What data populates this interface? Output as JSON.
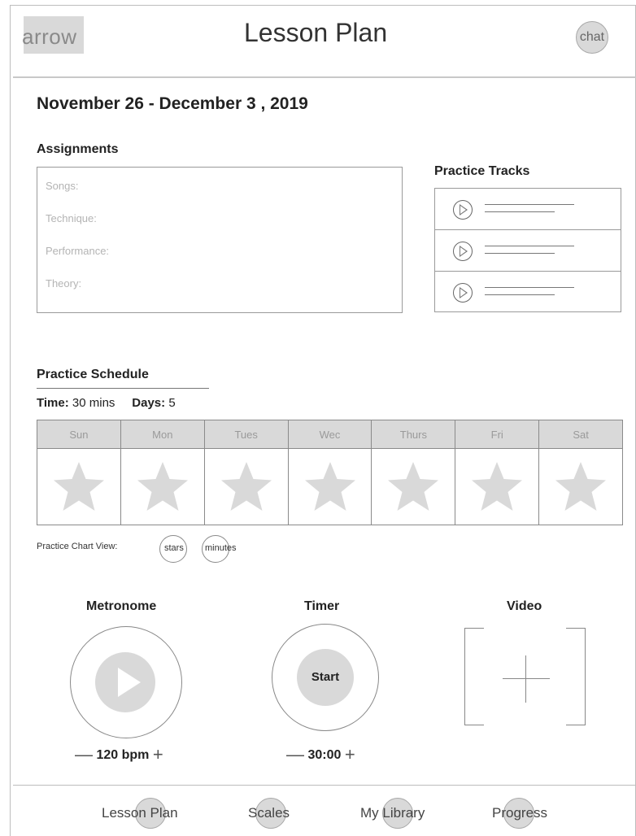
{
  "header": {
    "back_label": "arrow",
    "title": "Lesson Plan",
    "chat_label": "chat"
  },
  "date_range": "November 26 - December 3 , 2019",
  "assignments": {
    "heading": "Assignments",
    "items": [
      "Songs:",
      "Technique:",
      "Performance:",
      "Theory:"
    ]
  },
  "practice_tracks": {
    "heading": "Practice Tracks",
    "count": 3
  },
  "schedule": {
    "heading": "Practice Schedule",
    "time_label": "Time:",
    "time_value": "30 mins",
    "days_label": "Days:",
    "days_value": "5",
    "days": [
      "Sun",
      "Mon",
      "Tues",
      "Wec",
      "Thurs",
      "Fri",
      "Sat"
    ]
  },
  "chart_view": {
    "label": "Practice Chart View:",
    "option_stars": "stars",
    "option_minutes": "minutes"
  },
  "metronome": {
    "title": "Metronome",
    "minus": "—",
    "value": "120 bpm",
    "plus": "+"
  },
  "timer": {
    "title": "Timer",
    "start_label": "Start",
    "minus": "—",
    "value": "30:00",
    "plus": "+"
  },
  "video": {
    "title": "Video"
  },
  "bottom_nav": {
    "items": [
      "Lesson Plan",
      "Scales",
      "My Library",
      "Progress"
    ]
  },
  "colors": {
    "placeholder_fill": "#d9d9d9",
    "border": "#8a8a8a",
    "text": "#222222",
    "muted_text": "#b4b4b4"
  }
}
